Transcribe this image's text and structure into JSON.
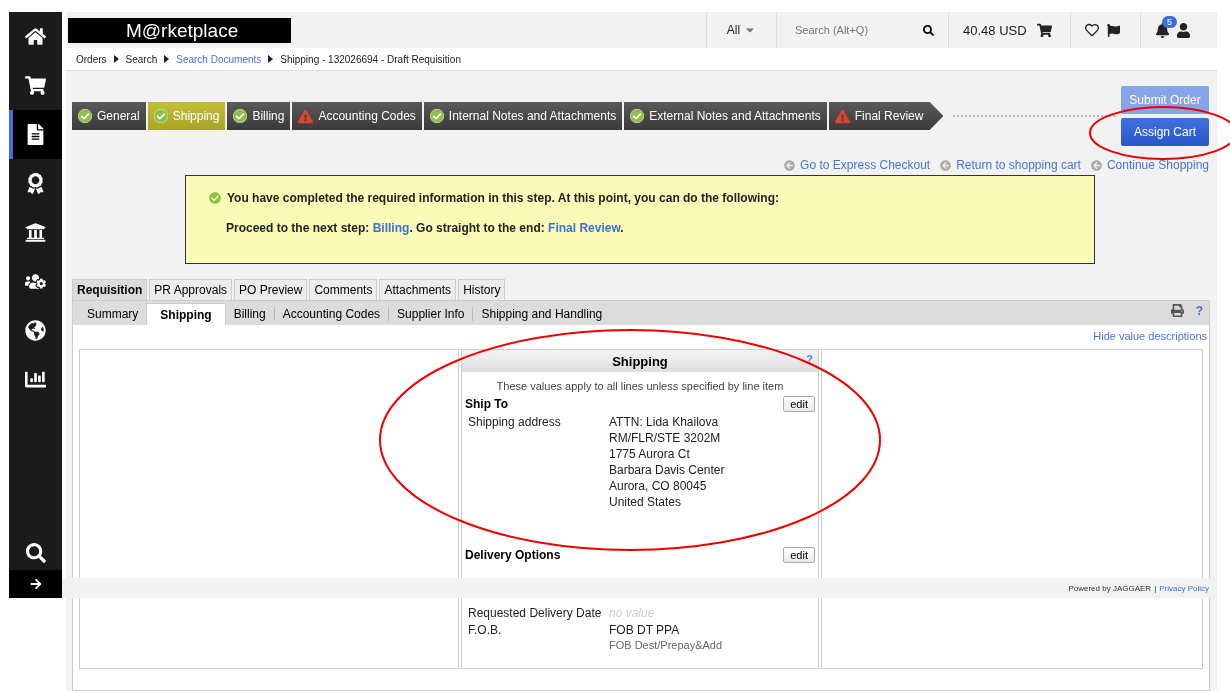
{
  "sidebar": {
    "items": [
      {
        "selected": false
      },
      {
        "selected": false
      },
      {
        "selected": true
      },
      {
        "selected": false
      },
      {
        "selected": false
      },
      {
        "selected": false
      },
      {
        "selected": false
      },
      {
        "selected": false
      }
    ]
  },
  "header": {
    "logo": "M@rketplace",
    "scope": "All",
    "search": {
      "placeholder": "Search (Alt+Q)"
    },
    "cart_total": "40.48 USD",
    "notifications": "5"
  },
  "breadcrumb": [
    {
      "label": "Orders",
      "link": false
    },
    {
      "label": "Search",
      "link": false
    },
    {
      "label": "Search Documents",
      "link": true
    },
    {
      "label": "Shipping - 132026694 - Draft Requisition",
      "link": false
    }
  ],
  "steps": [
    {
      "label": "General",
      "complete": true,
      "selected": false
    },
    {
      "label": "Shipping",
      "complete": true,
      "selected": true
    },
    {
      "label": "Billing",
      "complete": true,
      "selected": false
    },
    {
      "label": "Accounting Codes",
      "complete": false,
      "selected": false
    },
    {
      "label": "Internal Notes and Attachments",
      "complete": true,
      "selected": false
    },
    {
      "label": "External Notes and Attachments",
      "complete": true,
      "selected": false
    },
    {
      "label": "Final Review",
      "complete": false,
      "selected": false
    }
  ],
  "actions": [
    {
      "label": "Submit Order",
      "disabled": true
    },
    {
      "label": "Assign Cart",
      "disabled": false
    }
  ],
  "links": [
    "Go to Express Checkout",
    "Return to shopping cart",
    "Continue Shopping"
  ],
  "notice": {
    "line1": "You have completed the required information in this step. At this point, you can do the following:",
    "line2": [
      {
        "text": "Proceed to the next step: ",
        "link": false
      },
      {
        "text": "Billing",
        "link": true
      },
      {
        "text": ". Go straight to the end: ",
        "link": false
      },
      {
        "text": "Final Review",
        "link": true
      },
      {
        "text": ".",
        "link": false
      }
    ]
  },
  "tabs": [
    {
      "label": "Requisition",
      "selected": true
    },
    {
      "label": "PR Approvals",
      "selected": false
    },
    {
      "label": "PO Preview",
      "selected": false
    },
    {
      "label": "Comments",
      "selected": false
    },
    {
      "label": "Attachments",
      "selected": false
    },
    {
      "label": "History",
      "selected": false
    }
  ],
  "subtabs": [
    {
      "label": "Summary",
      "selected": false
    },
    {
      "label": "Shipping",
      "selected": true
    },
    {
      "label": "Billing",
      "selected": false
    },
    {
      "label": "Accounting Codes",
      "selected": false
    },
    {
      "label": "Supplier Info",
      "selected": false
    },
    {
      "label": "Shipping and Handling",
      "selected": false
    }
  ],
  "toolbar_help": "?",
  "hide_link": "Hide value descriptions",
  "panel": {
    "title": "Shipping",
    "help": "?",
    "note": "These values apply to all lines unless specified by line item",
    "sections": [
      {
        "title": "Ship To",
        "edit": "edit",
        "rows": [
          {
            "label": "Shipping address",
            "lines": [
              "ATTN: Lida Khailova",
              "RM/FLR/STE 3202M",
              "1775 Aurora Ct",
              "Barbara Davis Center",
              "Aurora, CO 80045",
              "United States"
            ],
            "empty": false
          }
        ]
      },
      {
        "title": "Delivery Options",
        "edit": "edit",
        "rows": [
          {
            "label": "Requested Delivery Date",
            "lines": [
              "no value"
            ],
            "empty": true
          },
          {
            "label": "F.O.B.",
            "lines": [
              "FOB DT PPA"
            ],
            "description": "FOB Dest/Prepay&Add",
            "empty": false
          }
        ]
      }
    ]
  },
  "footer": {
    "powered": "Powered by JAGGAER",
    "separator": "|",
    "privacy": "Privacy Policy"
  }
}
